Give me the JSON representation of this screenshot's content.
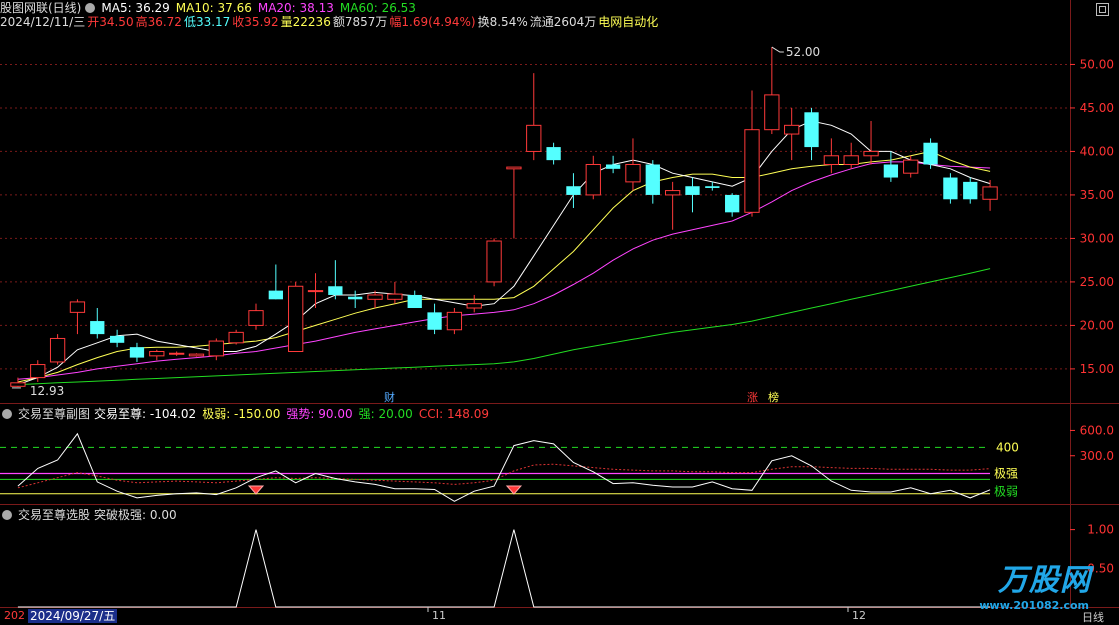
{
  "window": {
    "title": "股图网联(日线)",
    "restore_icon": "restore-window-icon"
  },
  "header": {
    "ma5_label": "MA5: 36.29",
    "ma10_label": "MA10: 37.66",
    "ma20_label": "MA20: 38.13",
    "ma60_label": "MA60: 26.53",
    "date": "2024/12/11/三",
    "open": "开34.50",
    "high": "高36.72",
    "low": "低33.17",
    "close": "收35.92",
    "volume": "量22236",
    "amount": "额7857万",
    "change": "幅1.69(4.94%)",
    "turnover": "换8.54%",
    "float": "流通2604万",
    "sector": "电网自动化"
  },
  "colors": {
    "up": "#ff3a3a",
    "down": "#54ffff",
    "ma5": "#ffffff",
    "ma10": "#ffff55",
    "ma20": "#ff44ff",
    "ma60": "#22dd22",
    "grid": "#7a1a1a",
    "axis_text": "#ff3333"
  },
  "main_panel": {
    "max_label": "52.00",
    "min_label": "12.93",
    "badges": [
      "财",
      "涨",
      "榜"
    ],
    "y_ticks": [
      "50.00",
      "45.00",
      "40.00",
      "35.00",
      "30.00",
      "25.00",
      "20.00",
      "15.00"
    ]
  },
  "sub1": {
    "title": "交易至尊副图",
    "v_main": "交易至尊: -104.02",
    "v_weak": "极弱: -150.00",
    "v_strong_trend": "强势: 90.00",
    "v_strong": "强: 20.00",
    "v_cci": "CCI: 148.09",
    "y_ticks": [
      "600.0",
      "300.0"
    ],
    "level_400": "400",
    "level_strong": "极强",
    "level_weak": "极弱"
  },
  "sub2": {
    "title": "交易至尊选股",
    "value": "突破极强: 0.00",
    "y_ticks": [
      "1.00",
      "0.50"
    ]
  },
  "x_axis": {
    "left_year": "202",
    "cursor_date": "2024/09/27/五",
    "m11": "11",
    "m12": "12",
    "period": "日线"
  },
  "logo": {
    "name": "万股网",
    "url": "www.201082.com"
  },
  "chart_data": {
    "type": "candlestick",
    "ylim": [
      12.0,
      53.5
    ],
    "candles": [
      {
        "o": 13.0,
        "h": 14.0,
        "l": 12.93,
        "c": 13.4
      },
      {
        "o": 14.0,
        "h": 16.0,
        "l": 13.5,
        "c": 15.5
      },
      {
        "o": 15.8,
        "h": 19.0,
        "l": 15.5,
        "c": 18.5
      },
      {
        "o": 21.5,
        "h": 23.0,
        "l": 19.0,
        "c": 22.7
      },
      {
        "o": 20.5,
        "h": 22.0,
        "l": 18.5,
        "c": 19.0
      },
      {
        "o": 18.8,
        "h": 19.5,
        "l": 17.5,
        "c": 18.0
      },
      {
        "o": 17.5,
        "h": 18.0,
        "l": 15.8,
        "c": 16.3
      },
      {
        "o": 16.5,
        "h": 17.2,
        "l": 16.0,
        "c": 17.0
      },
      {
        "o": 16.8,
        "h": 17.0,
        "l": 16.5,
        "c": 16.8
      },
      {
        "o": 16.5,
        "h": 16.8,
        "l": 16.4,
        "c": 16.7
      },
      {
        "o": 16.5,
        "h": 18.5,
        "l": 16.0,
        "c": 18.2
      },
      {
        "o": 18.0,
        "h": 19.5,
        "l": 17.8,
        "c": 19.2
      },
      {
        "o": 20.0,
        "h": 22.5,
        "l": 19.5,
        "c": 21.7
      },
      {
        "o": 24.0,
        "h": 27.0,
        "l": 23.0,
        "c": 23.0
      },
      {
        "o": 17.0,
        "h": 25.0,
        "l": 17.0,
        "c": 24.5
      },
      {
        "o": 24.0,
        "h": 26.0,
        "l": 22.0,
        "c": 24.0
      },
      {
        "o": 24.5,
        "h": 27.5,
        "l": 23.0,
        "c": 23.5
      },
      {
        "o": 23.3,
        "h": 24.0,
        "l": 22.0,
        "c": 23.0
      },
      {
        "o": 23.0,
        "h": 24.0,
        "l": 22.0,
        "c": 23.5
      },
      {
        "o": 23.0,
        "h": 25.0,
        "l": 22.5,
        "c": 23.6
      },
      {
        "o": 23.5,
        "h": 24.0,
        "l": 22.0,
        "c": 22.0
      },
      {
        "o": 21.5,
        "h": 22.5,
        "l": 19.0,
        "c": 19.5
      },
      {
        "o": 19.5,
        "h": 22.0,
        "l": 19.0,
        "c": 21.5
      },
      {
        "o": 22.0,
        "h": 23.5,
        "l": 21.5,
        "c": 22.5
      },
      {
        "o": 25.0,
        "h": 30.0,
        "l": 24.5,
        "c": 29.7
      },
      {
        "o": 38.0,
        "h": 38.2,
        "l": 30.0,
        "c": 38.2
      },
      {
        "o": 40.0,
        "h": 49.0,
        "l": 39.0,
        "c": 43.0
      },
      {
        "o": 40.5,
        "h": 41.0,
        "l": 38.5,
        "c": 39.0
      },
      {
        "o": 36.0,
        "h": 37.5,
        "l": 33.5,
        "c": 35.0
      },
      {
        "o": 35.0,
        "h": 39.5,
        "l": 34.5,
        "c": 38.5
      },
      {
        "o": 38.5,
        "h": 39.5,
        "l": 37.5,
        "c": 38.0
      },
      {
        "o": 36.5,
        "h": 41.5,
        "l": 35.5,
        "c": 38.5
      },
      {
        "o": 38.5,
        "h": 39.0,
        "l": 34.0,
        "c": 35.0
      },
      {
        "o": 35.0,
        "h": 36.5,
        "l": 31.0,
        "c": 35.5
      },
      {
        "o": 36.0,
        "h": 37.0,
        "l": 33.0,
        "c": 35.0
      },
      {
        "o": 36.0,
        "h": 36.5,
        "l": 35.5,
        "c": 35.8
      },
      {
        "o": 35.0,
        "h": 35.2,
        "l": 32.5,
        "c": 33.0
      },
      {
        "o": 33.0,
        "h": 47.0,
        "l": 32.5,
        "c": 42.5
      },
      {
        "o": 42.5,
        "h": 52.0,
        "l": 42.0,
        "c": 46.5
      },
      {
        "o": 42.0,
        "h": 45.0,
        "l": 39.0,
        "c": 43.0
      },
      {
        "o": 44.5,
        "h": 45.0,
        "l": 39.0,
        "c": 40.5
      },
      {
        "o": 38.5,
        "h": 41.5,
        "l": 37.5,
        "c": 39.5
      },
      {
        "o": 38.5,
        "h": 41.0,
        "l": 38.0,
        "c": 39.5
      },
      {
        "o": 39.5,
        "h": 43.5,
        "l": 38.5,
        "c": 40.0
      },
      {
        "o": 38.5,
        "h": 40.0,
        "l": 36.5,
        "c": 37.0
      },
      {
        "o": 37.5,
        "h": 39.5,
        "l": 37.0,
        "c": 39.0
      },
      {
        "o": 41.0,
        "h": 41.5,
        "l": 38.0,
        "c": 38.5
      },
      {
        "o": 37.0,
        "h": 37.5,
        "l": 34.0,
        "c": 34.5
      },
      {
        "o": 36.5,
        "h": 37.0,
        "l": 34.0,
        "c": 34.5
      },
      {
        "o": 34.5,
        "h": 36.72,
        "l": 33.17,
        "c": 35.92
      }
    ],
    "ma5": [
      13.2,
      14.0,
      15.2,
      17.2,
      18.0,
      18.8,
      19.0,
      18.2,
      17.8,
      17.4,
      17.0,
      17.0,
      17.6,
      19.0,
      20.5,
      22.5,
      23.5,
      23.5,
      23.8,
      23.6,
      23.4,
      23.0,
      22.6,
      22.2,
      22.5,
      24.5,
      28.0,
      31.5,
      35.0,
      37.5,
      38.5,
      39.0,
      38.5,
      37.5,
      37.0,
      36.5,
      36.0,
      37.0,
      40.0,
      42.5,
      43.5,
      43.0,
      42.0,
      40.0,
      40.0,
      39.0,
      38.5,
      38.0,
      37.0,
      36.3
    ],
    "ma10": [
      13.5,
      14.0,
      14.6,
      15.5,
      16.3,
      17.0,
      17.4,
      17.5,
      17.5,
      17.6,
      17.8,
      18.0,
      18.2,
      18.6,
      19.3,
      20.0,
      20.7,
      21.4,
      22.0,
      22.5,
      23.0,
      23.0,
      23.0,
      23.0,
      23.0,
      23.2,
      24.5,
      26.5,
      28.5,
      31.0,
      33.5,
      35.5,
      36.5,
      37.0,
      37.4,
      37.4,
      37.0,
      37.0,
      37.5,
      38.0,
      38.3,
      38.5,
      38.5,
      38.8,
      39.0,
      39.5,
      40.0,
      39.0,
      38.2,
      37.7
    ],
    "ma20": [
      13.8,
      14.0,
      14.3,
      14.6,
      15.0,
      15.3,
      15.6,
      15.9,
      16.1,
      16.3,
      16.5,
      16.8,
      17.0,
      17.4,
      17.8,
      18.2,
      18.7,
      19.2,
      19.6,
      20.0,
      20.4,
      20.8,
      21.1,
      21.3,
      21.5,
      21.8,
      22.5,
      23.5,
      24.7,
      26.0,
      27.5,
      28.8,
      29.8,
      30.5,
      31.0,
      31.5,
      32.0,
      33.0,
      34.2,
      35.5,
      36.5,
      37.3,
      38.0,
      38.6,
      38.8,
      38.8,
      38.5,
      38.3,
      38.2,
      38.1
    ],
    "ma60": [
      13.2,
      13.3,
      13.4,
      13.5,
      13.6,
      13.7,
      13.8,
      13.9,
      14.0,
      14.1,
      14.2,
      14.3,
      14.4,
      14.5,
      14.6,
      14.7,
      14.8,
      14.9,
      15.0,
      15.1,
      15.2,
      15.3,
      15.4,
      15.5,
      15.6,
      15.8,
      16.2,
      16.7,
      17.2,
      17.6,
      18.0,
      18.4,
      18.8,
      19.2,
      19.5,
      19.8,
      20.1,
      20.5,
      21.0,
      21.5,
      22.0,
      22.5,
      23.0,
      23.5,
      24.0,
      24.5,
      25.0,
      25.5,
      26.0,
      26.53
    ],
    "sub1": {
      "ylim": [
        -260,
        700
      ],
      "main_line": [
        -60,
        150,
        250,
        560,
        -10,
        -120,
        -200,
        -170,
        -150,
        -140,
        -160,
        -80,
        40,
        120,
        -20,
        90,
        30,
        -10,
        -40,
        -90,
        -90,
        -100,
        -240,
        -120,
        -60,
        420,
        480,
        440,
        220,
        110,
        -30,
        -20,
        -50,
        -70,
        -70,
        -10,
        -90,
        -110,
        240,
        300,
        180,
        0,
        -110,
        -130,
        -130,
        -80,
        -150,
        -110,
        -200,
        -104
      ],
      "cci_line": [
        -80,
        -20,
        40,
        100,
        60,
        10,
        -20,
        -10,
        0,
        -10,
        -20,
        0,
        20,
        40,
        30,
        40,
        30,
        20,
        10,
        0,
        -10,
        -20,
        -40,
        -20,
        10,
        120,
        190,
        200,
        180,
        160,
        140,
        130,
        120,
        120,
        110,
        110,
        100,
        100,
        140,
        170,
        170,
        160,
        150,
        150,
        140,
        140,
        140,
        130,
        130,
        148
      ],
      "level_400": 400,
      "level_strong": 90,
      "level_trend": 20,
      "level_weak": -150,
      "signals": [
        12,
        25
      ]
    },
    "sub2": {
      "ylim": [
        0,
        1.15
      ],
      "values": [
        0,
        0,
        0,
        0,
        0,
        0,
        0,
        0,
        0,
        0,
        0,
        0,
        1,
        0,
        0,
        0,
        0,
        0,
        0,
        0,
        0,
        0,
        0,
        0,
        0,
        1,
        0,
        0,
        0,
        0,
        0,
        0,
        0,
        0,
        0,
        0,
        0,
        0,
        0,
        0,
        0,
        0,
        0,
        0,
        0,
        0,
        0,
        0,
        0,
        0
      ]
    }
  }
}
